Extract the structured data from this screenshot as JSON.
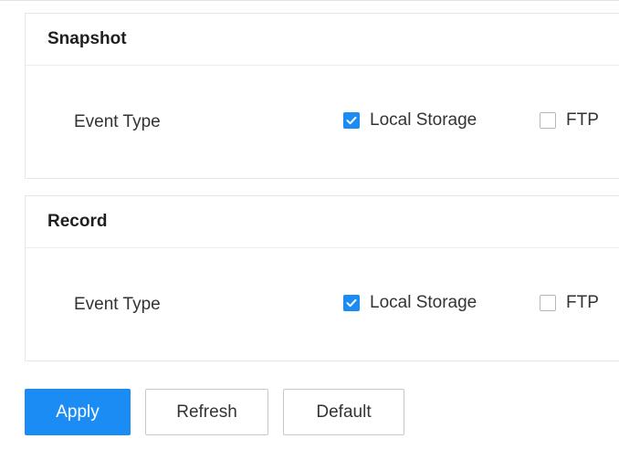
{
  "snapshot": {
    "title": "Snapshot",
    "event_type_label": "Event Type",
    "options": [
      {
        "label": "Local Storage",
        "checked": true
      },
      {
        "label": "FTP",
        "checked": false
      }
    ]
  },
  "record": {
    "title": "Record",
    "event_type_label": "Event Type",
    "options": [
      {
        "label": "Local Storage",
        "checked": true
      },
      {
        "label": "FTP",
        "checked": false
      }
    ]
  },
  "buttons": {
    "apply": "Apply",
    "refresh": "Refresh",
    "default": "Default"
  },
  "colors": {
    "accent": "#1a8cf3",
    "border": "#e6e6e6",
    "text": "#333333"
  },
  "icons": {
    "checked": "checkmark-icon"
  }
}
